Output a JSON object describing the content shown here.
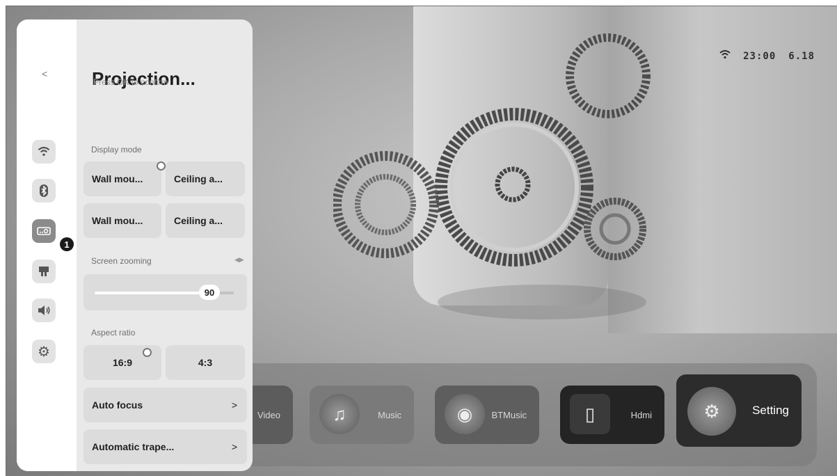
{
  "status": {
    "time": "23:00",
    "version": "6.18",
    "wifi_icon": "wifi-icon"
  },
  "panel": {
    "back_label": "<",
    "title": "Projection...",
    "subtitle": "Press OK to confirm",
    "badge": "1",
    "rail_icons": [
      "wifi-icon",
      "bluetooth-icon",
      "projector-icon",
      "keystone-icon",
      "volume-icon",
      "gear-icon"
    ],
    "display_mode": {
      "label": "Display mode",
      "options": [
        "Wall mou...",
        "Ceiling a...",
        "Wall mou...",
        "Ceiling a..."
      ],
      "selected_index": 0
    },
    "screen_zooming": {
      "label": "Screen zooming",
      "value": "90",
      "fraction": 0.9
    },
    "aspect_ratio": {
      "label": "Aspect ratio",
      "options": [
        "16:9",
        "4:3"
      ],
      "selected_index": 0
    },
    "auto_focus": {
      "label": "Auto focus",
      "chevron": ">"
    },
    "keystone": {
      "label": "Automatic trape...",
      "chevron": ">"
    }
  },
  "dock": {
    "apps": [
      {
        "label": "Video",
        "icon": "video-icon"
      },
      {
        "label": "Music",
        "icon": "music-note-icon"
      },
      {
        "label": "BTMusic",
        "icon": "bluetooth-speaker-icon"
      },
      {
        "label": "Hdmi",
        "icon": "hdmi-icon"
      },
      {
        "label": "Setting",
        "icon": "settings-app-icon"
      }
    ]
  },
  "colors": {
    "panel_bg": "#e9e9e9",
    "rail_active": "#8b8b8b",
    "tile_bg": "#dcdcdc",
    "badge_bg": "#1a1a1a"
  }
}
